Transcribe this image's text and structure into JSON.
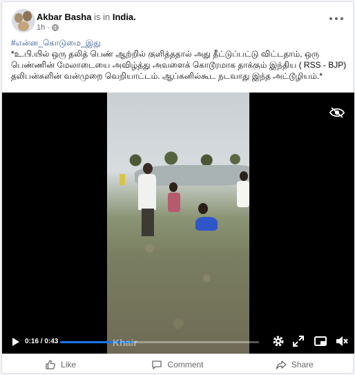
{
  "post": {
    "author": "Akbar Basha",
    "is_in": " is in ",
    "location": "India.",
    "time": "1h ·",
    "hashtag": "#என்ன_கொடுமை_இது",
    "body": "*உ.பி.யில் ஒரு தலித் பெண் ஆற்றில் குளித்ததால் அது தீட்டுப்பட்டு விட்டதாம், ஒரு பெண்ணின் மேலாடையை அவிழ்த்து அவளைக் கொடூரமாக தாக்கும் இந்திய ( RSS - BJP) தலிபன்களின் வன்முறை வெறியாட்டம். ஆப்கனில்கூட நடவாது இந்த அட்டூழியம்.*"
  },
  "video": {
    "time": "0:16 / 0:43",
    "progress": 0.372,
    "watermark": "Khair"
  },
  "actions": {
    "like": "Like",
    "comment": "Comment",
    "share": "Share"
  },
  "colors": {
    "accent": "#1877f2",
    "hashtag": "#385898",
    "muted": "#65676b"
  },
  "icons": [
    "globe-icon",
    "more-icon",
    "eye-off-icon",
    "play-icon",
    "gear-icon",
    "fullscreen-icon",
    "pip-icon",
    "volume-icon",
    "like-icon",
    "comment-icon",
    "share-icon"
  ]
}
